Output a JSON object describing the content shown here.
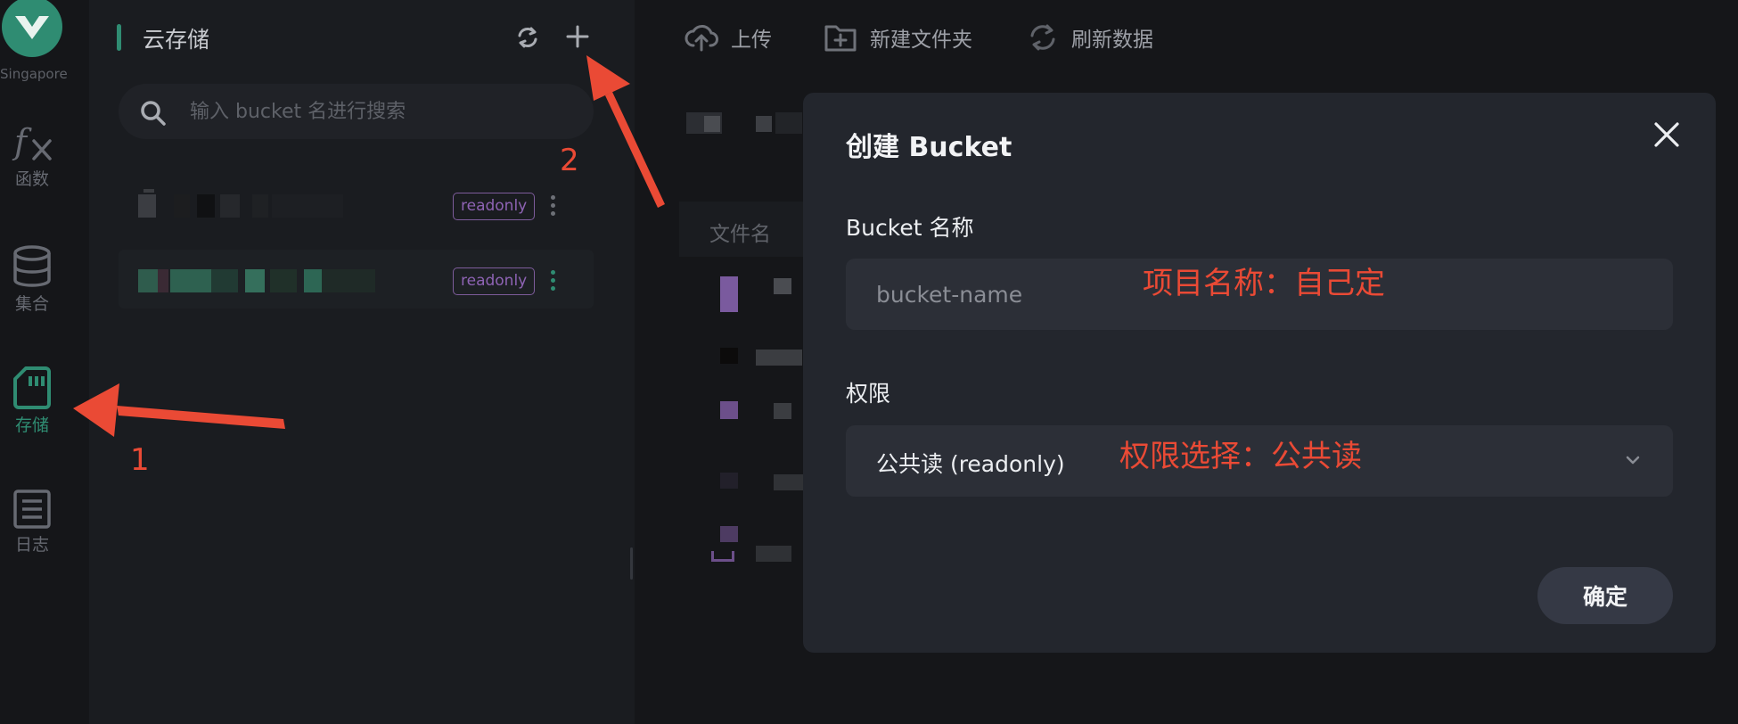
{
  "rail": {
    "region": "Singapore",
    "items": [
      {
        "label": "函数",
        "icon": "function-icon"
      },
      {
        "label": "集合",
        "icon": "database-icon"
      },
      {
        "label": "存储",
        "icon": "storage-card-icon",
        "active": true
      },
      {
        "label": "日志",
        "icon": "log-icon"
      }
    ]
  },
  "sidebar": {
    "title": "云存储",
    "search_placeholder": "输入 bucket 名进行搜索",
    "buckets": [
      {
        "badge": "readonly"
      },
      {
        "badge": "readonly",
        "selected": true
      }
    ]
  },
  "toolbar": {
    "upload_label": "上传",
    "new_folder_label": "新建文件夹",
    "refresh_label": "刷新数据"
  },
  "table": {
    "filename_header": "文件名"
  },
  "modal": {
    "title": "创建 Bucket",
    "name_label": "Bucket 名称",
    "name_placeholder": "bucket-name",
    "permission_label": "权限",
    "permission_value": "公共读 (readonly)",
    "confirm_label": "确定"
  },
  "annotations": {
    "step1": "1",
    "step2": "2",
    "name_note": "项目名称：自己定",
    "permission_note": "权限选择：公共读"
  },
  "colors": {
    "accent": "#2f8c72",
    "annotation": "#ea4a35",
    "badge": "#8e63b4",
    "modal_bg": "#23262d"
  }
}
